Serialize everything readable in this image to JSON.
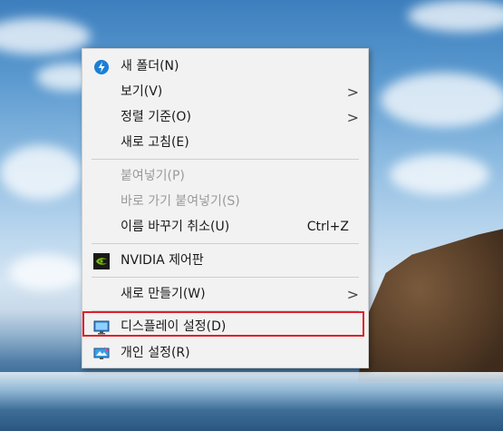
{
  "menu": {
    "items": [
      {
        "label": "새 폴더(N)",
        "icon": "new-folder-shield-icon"
      },
      {
        "label": "보기(V)",
        "submenu": true
      },
      {
        "label": "정렬 기준(O)",
        "submenu": true
      },
      {
        "label": "새로 고침(E)"
      },
      {
        "label": "붙여넣기(P)",
        "disabled": true
      },
      {
        "label": "바로 가기 붙여넣기(S)",
        "disabled": true
      },
      {
        "label": "이름 바꾸기 취소(U)",
        "shortcut": "Ctrl+Z"
      },
      {
        "label": "NVIDIA 제어판",
        "icon": "nvidia-icon"
      },
      {
        "label": "새로 만들기(W)",
        "submenu": true
      },
      {
        "label": "디스플레이 설정(D)",
        "icon": "display-icon",
        "highlighted": true
      },
      {
        "label": "개인 설정(R)",
        "icon": "personalize-icon"
      }
    ],
    "submenu_arrow": ">"
  },
  "colors": {
    "highlight_border": "#e0202a",
    "menu_background": "#f2f2f2",
    "disabled_text": "#9a9a9a"
  }
}
